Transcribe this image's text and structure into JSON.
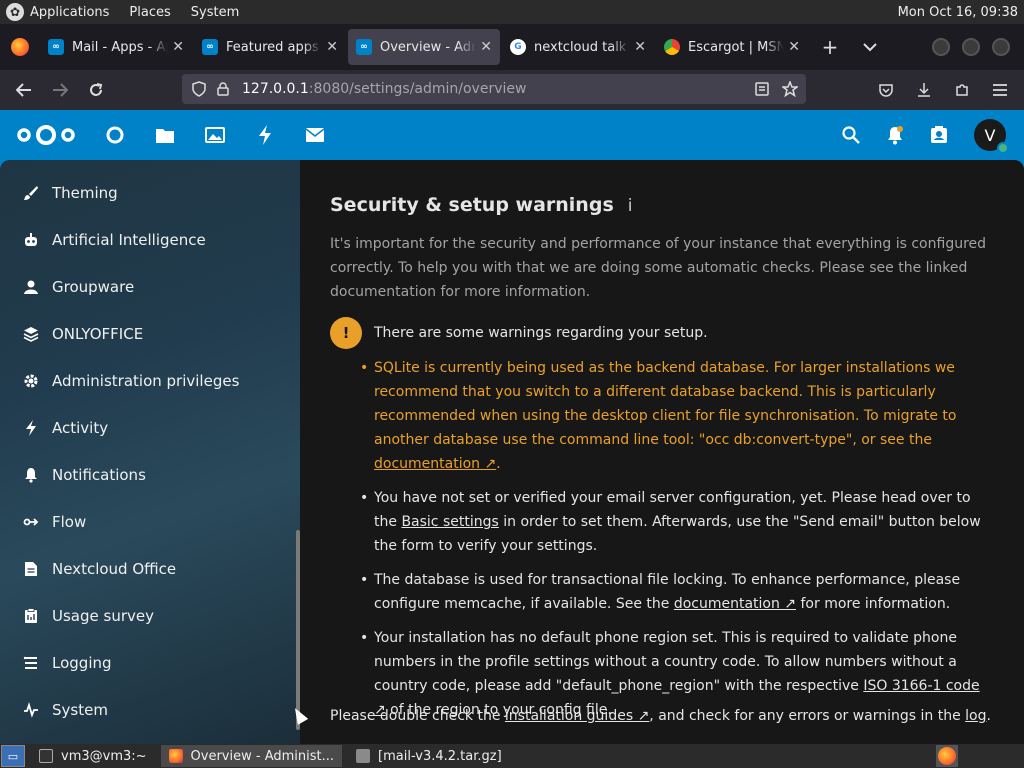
{
  "gnome_panel": {
    "menus": [
      "Applications",
      "Places",
      "System"
    ],
    "clock": "Mon Oct 16, 09:38"
  },
  "browser": {
    "tabs": [
      {
        "label": "Mail - Apps - Ap",
        "icon": "nextcloud-icon",
        "active": false
      },
      {
        "label": "Featured apps -",
        "icon": "nextcloud-icon",
        "active": false
      },
      {
        "label": "Overview - Adm",
        "icon": "nextcloud-icon",
        "active": true
      },
      {
        "label": "nextcloud talk d",
        "icon": "google-icon",
        "active": false
      },
      {
        "label": "Escargot | MSN",
        "icon": "chrome-icon",
        "active": false
      }
    ],
    "url_host": "127.0.0.1",
    "url_path": ":8080/settings/admin/overview"
  },
  "nextcloud": {
    "header_apps": [
      "dashboard-icon",
      "files-icon",
      "photos-icon",
      "activity-icon",
      "mail-icon"
    ],
    "avatar_letter": "V",
    "sidebar": [
      {
        "label": "Theming",
        "icon": "brush-icon"
      },
      {
        "label": "Artificial Intelligence",
        "icon": "robot-icon"
      },
      {
        "label": "Groupware",
        "icon": "person-icon"
      },
      {
        "label": "ONLYOFFICE",
        "icon": "layers-icon"
      },
      {
        "label": "Administration privileges",
        "icon": "gear-icon"
      },
      {
        "label": "Activity",
        "icon": "lightning-icon"
      },
      {
        "label": "Notifications",
        "icon": "bell-icon"
      },
      {
        "label": "Flow",
        "icon": "flow-icon"
      },
      {
        "label": "Nextcloud Office",
        "icon": "document-icon"
      },
      {
        "label": "Usage survey",
        "icon": "clipboard-icon"
      },
      {
        "label": "Logging",
        "icon": "list-icon"
      },
      {
        "label": "System",
        "icon": "pulse-icon"
      }
    ],
    "main": {
      "title": "Security & setup warnings",
      "info_glyph": "i",
      "intro": "It's important for the security and performance of your instance that everything is configured correctly. To help you with that we are doing some automatic checks. Please see the linked documentation for more information.",
      "warning_badge": "!",
      "warning_header": "There are some warnings regarding your setup.",
      "w1_text": "SQLite is currently being used as the backend database. For larger installations we recommend that you switch to a different database backend. This is particularly recommended when using the desktop client for file synchronisation. To migrate to another database use the command line tool: \"occ db:convert-type\", or see the ",
      "w1_link": "documentation ↗",
      "w1_end": ".",
      "w2_text": "You have not set or verified your email server configuration, yet. Please head over to the ",
      "w2_link": "Basic settings",
      "w2_end": " in order to set them. Afterwards, use the \"Send email\" button below the form to verify your settings.",
      "w3_text": "The database is used for transactional file locking. To enhance performance, please configure memcache, if available. See the ",
      "w3_link": "documentation ↗",
      "w3_end": " for more information.",
      "w4_text": "Your installation has no default phone region set. This is required to validate phone numbers in the profile settings without a country code. To allow numbers without a country code, please add \"default_phone_region\" with the respective ",
      "w4_link": "ISO 3166-1 code ↗",
      "w4_end": " of the region to your config file.",
      "footer_a": "Please double check the ",
      "footer_link1": "installation guides ↗",
      "footer_b": ", and check for any errors or warnings in the ",
      "footer_link2": "log",
      "footer_c": "."
    }
  },
  "taskbar": {
    "items": [
      {
        "label": "vm3@vm3:~",
        "active": false
      },
      {
        "label": "Overview - Administ...",
        "active": true
      },
      {
        "label": "[mail-v3.4.2.tar.gz]",
        "active": false
      }
    ]
  },
  "colors": {
    "nextcloud_blue": "#0082c9",
    "warning_orange": "#e9a02b"
  }
}
